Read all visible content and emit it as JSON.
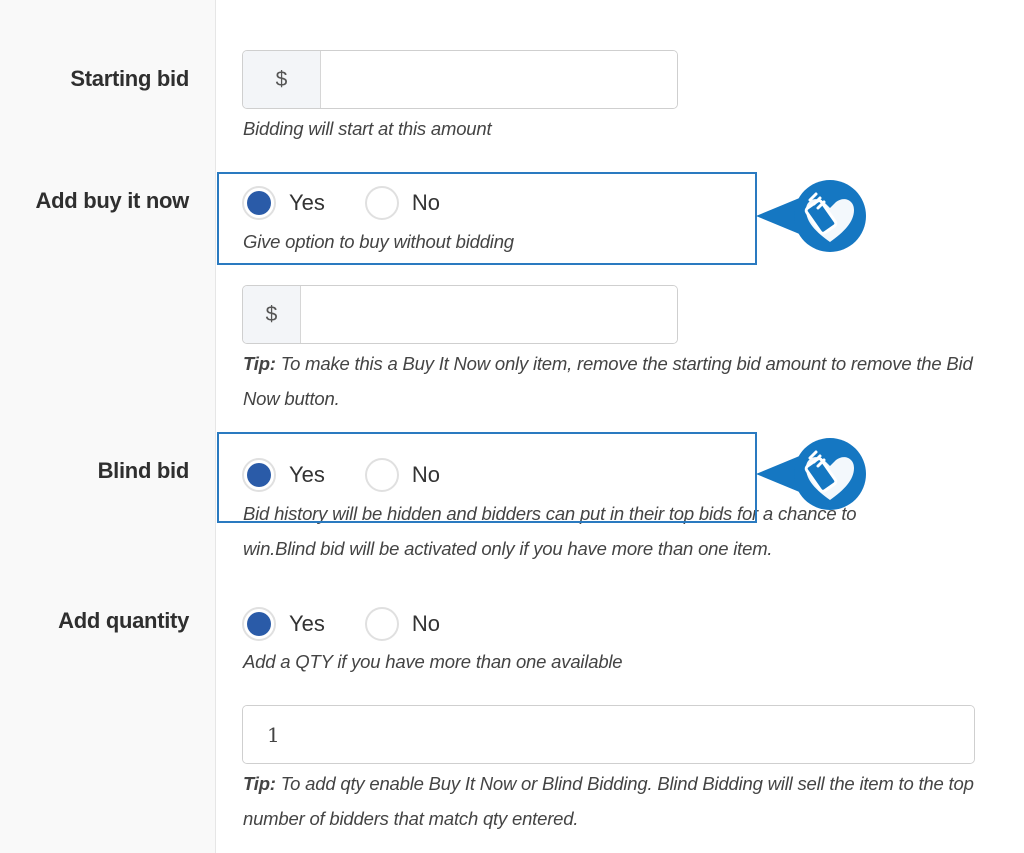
{
  "form": {
    "starting_bid": {
      "label": "Starting bid",
      "currency_symbol": "$",
      "value": "",
      "help": "Bidding will start at this amount"
    },
    "buy_it_now": {
      "label": "Add buy it now",
      "options": [
        "Yes",
        "No"
      ],
      "selected": "Yes",
      "help": "Give option to buy without bidding",
      "currency_symbol": "$",
      "price_value": "",
      "tip_prefix": "Tip:",
      "tip": " To make this a Buy It Now only item, remove the starting bid amount to remove the Bid Now button."
    },
    "blind_bid": {
      "label": "Blind bid",
      "options": [
        "Yes",
        "No"
      ],
      "selected": "Yes",
      "help": "Bid history will be hidden and bidders can put in their top bids for a chance to win.Blind bid will be activated only if you have more than one item."
    },
    "quantity": {
      "label": "Add quantity",
      "options": [
        "Yes",
        "No"
      ],
      "selected": "Yes",
      "help": "Add a QTY if you have more than one available",
      "value": "1",
      "tip_prefix": "Tip:",
      "tip": " To add qty enable Buy It Now or Blind Bidding. Blind Bidding will sell the item to the top number of bidders that match qty entered."
    }
  },
  "annotations": {
    "highlight_color": "#2a7ac0",
    "pointer_icon": "hand-heart-icon"
  }
}
